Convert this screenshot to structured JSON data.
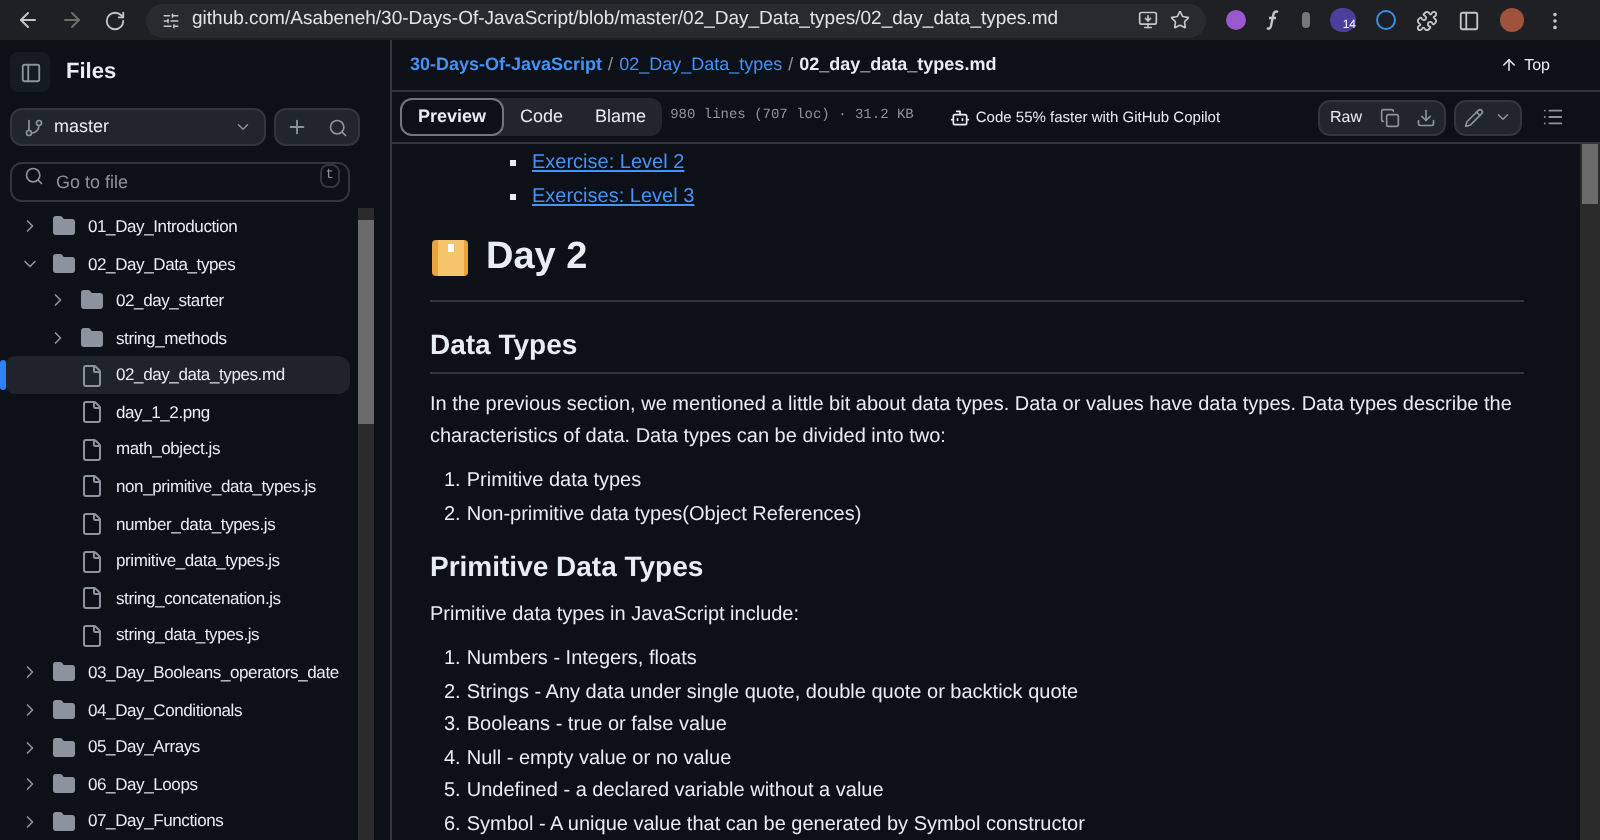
{
  "browser": {
    "url": "github.com/Asabeneh/30-Days-Of-JavaScript/blob/master/02_Day_Data_types/02_day_data_types.md",
    "extension_badge": "14"
  },
  "sidebar": {
    "title": "Files",
    "branch": "master",
    "search": {
      "placeholder": "Go to file",
      "shortcut": "t"
    },
    "tree": [
      {
        "name": "01_Day_Introduction",
        "kind": "folder",
        "expanded": false,
        "selected": false
      },
      {
        "name": "02_Day_Data_types",
        "kind": "folder",
        "expanded": true,
        "selected": false,
        "children": [
          {
            "name": "02_day_starter",
            "kind": "folder",
            "expanded": false,
            "selected": false
          },
          {
            "name": "string_methods",
            "kind": "folder",
            "expanded": false,
            "selected": false
          },
          {
            "name": "02_day_data_types.md",
            "kind": "file",
            "selected": true
          },
          {
            "name": "day_1_2.png",
            "kind": "file",
            "selected": false
          },
          {
            "name": "math_object.js",
            "kind": "file",
            "selected": false
          },
          {
            "name": "non_primitive_data_types.js",
            "kind": "file",
            "selected": false
          },
          {
            "name": "number_data_types.js",
            "kind": "file",
            "selected": false
          },
          {
            "name": "primitive_data_types.js",
            "kind": "file",
            "selected": false
          },
          {
            "name": "string_concatenation.js",
            "kind": "file",
            "selected": false
          },
          {
            "name": "string_data_types.js",
            "kind": "file",
            "selected": false
          }
        ]
      },
      {
        "name": "03_Day_Booleans_operators_date",
        "kind": "folder",
        "expanded": false,
        "selected": false
      },
      {
        "name": "04_Day_Conditionals",
        "kind": "folder",
        "expanded": false,
        "selected": false
      },
      {
        "name": "05_Day_Arrays",
        "kind": "folder",
        "expanded": false,
        "selected": false
      },
      {
        "name": "06_Day_Loops",
        "kind": "folder",
        "expanded": false,
        "selected": false
      },
      {
        "name": "07_Day_Functions",
        "kind": "folder",
        "expanded": false,
        "selected": false
      }
    ]
  },
  "breadcrumb": {
    "repo": "30-Days-Of-JavaScript",
    "separator": "/",
    "folder": "02_Day_Data_types",
    "file": "02_day_data_types.md",
    "top": "Top"
  },
  "toolbar": {
    "tabs": [
      {
        "label": "Preview",
        "selected": true
      },
      {
        "label": "Code",
        "selected": false
      },
      {
        "label": "Blame",
        "selected": false
      }
    ],
    "file_info": "980 lines (707 loc) · 31.2 KB",
    "copilot": "Code 55% faster with GitHub Copilot",
    "raw": "Raw"
  },
  "content": {
    "toc_links": [
      "Exercise: Level 2",
      "Exercises: Level 3"
    ],
    "title": "Day 2",
    "sections": [
      {
        "heading": "Data Types",
        "paragraph": "In the previous section, we mentioned a little bit about data types. Data or values have data types. Data types describe the characteristics of data. Data types can be divided into two:",
        "items": [
          {
            "number": "1.",
            "text": "Primitive data types"
          },
          {
            "number": "2.",
            "text": "Non-primitive data types(Object References)"
          }
        ]
      },
      {
        "heading": "Primitive Data Types",
        "paragraph": "Primitive data types in JavaScript include:",
        "items": [
          {
            "number": "1.",
            "text": "Numbers - Integers, floats"
          },
          {
            "number": "2.",
            "text": "Strings - Any data under single quote, double quote or backtick quote"
          },
          {
            "number": "3.",
            "text": "Booleans - true or false value"
          },
          {
            "number": "4.",
            "text": "Null - empty value or no value"
          },
          {
            "number": "5.",
            "text": "Undefined - a declared variable without a value"
          },
          {
            "number": "6.",
            "text": "Symbol - A unique value that can be generated by Symbol constructor"
          }
        ]
      }
    ]
  }
}
